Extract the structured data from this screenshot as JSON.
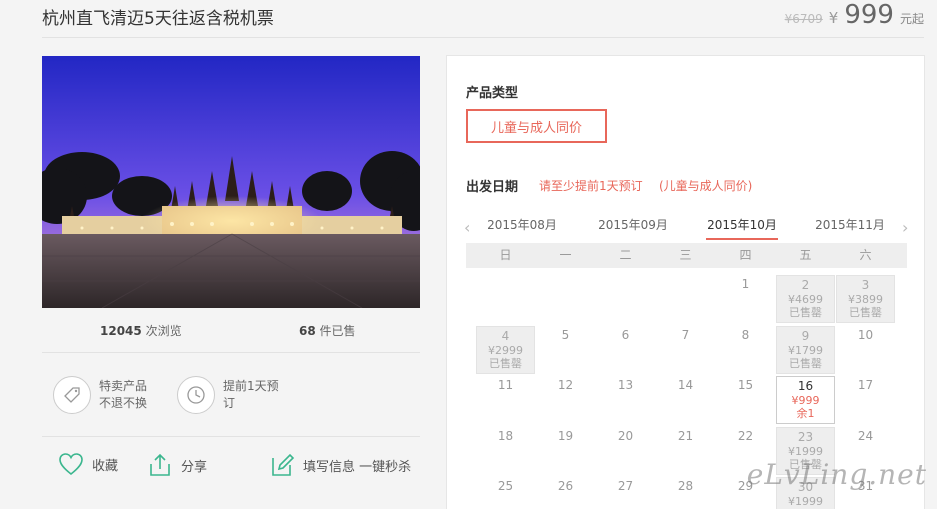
{
  "product": {
    "title": "杭州直飞清迈5天往返含税机票",
    "original_price": "¥6709",
    "currency": "¥",
    "price": "999",
    "unit": "元起"
  },
  "stats": {
    "views_count": "12045",
    "views_label": "次浏览",
    "sold_count": "68",
    "sold_label": "件已售"
  },
  "features": [
    {
      "icon": "tag-icon",
      "line1": "特卖产品",
      "line2": "不退不换"
    },
    {
      "icon": "clock-icon",
      "line1": "提前1天预",
      "line2": "订"
    }
  ],
  "actions": {
    "favorite": "收藏",
    "share": "分享",
    "fill_info": "填写信息 一键秒杀"
  },
  "booking": {
    "product_type_label": "产品类型",
    "product_type_option": "儿童与成人同价",
    "date_label": "出发日期",
    "date_note1": "请至少提前1天预订",
    "date_note2": "(儿童与成人同价)",
    "months": [
      "2015年08月",
      "2015年09月",
      "2015年10月",
      "2015年11月"
    ],
    "active_month_index": 2,
    "weekdays": [
      "日",
      "一",
      "二",
      "三",
      "四",
      "五",
      "六"
    ],
    "calendar": [
      [
        null,
        null,
        null,
        null,
        {
          "d": "1"
        },
        {
          "d": "2",
          "p": "¥4699",
          "s": "已售罄",
          "st": "soldout"
        },
        {
          "d": "3",
          "p": "¥3899",
          "s": "已售罄",
          "st": "soldout"
        }
      ],
      [
        {
          "d": "4",
          "p": "¥2999",
          "s": "已售罄",
          "st": "soldout"
        },
        {
          "d": "5"
        },
        {
          "d": "6"
        },
        {
          "d": "7"
        },
        {
          "d": "8"
        },
        {
          "d": "9",
          "p": "¥1799",
          "s": "已售罄",
          "st": "soldout"
        },
        {
          "d": "10"
        }
      ],
      [
        {
          "d": "11"
        },
        {
          "d": "12"
        },
        {
          "d": "13"
        },
        {
          "d": "14"
        },
        {
          "d": "15"
        },
        {
          "d": "16",
          "p": "¥999",
          "s": "余1",
          "st": "avail"
        },
        {
          "d": "17"
        }
      ],
      [
        {
          "d": "18"
        },
        {
          "d": "19"
        },
        {
          "d": "20"
        },
        {
          "d": "21"
        },
        {
          "d": "22"
        },
        {
          "d": "23",
          "p": "¥1999",
          "s": "已售罄",
          "st": "soldout"
        },
        {
          "d": "24"
        }
      ],
      [
        {
          "d": "25"
        },
        {
          "d": "26"
        },
        {
          "d": "27"
        },
        {
          "d": "28"
        },
        {
          "d": "29"
        },
        {
          "d": "30",
          "p": "¥1999",
          "s": "",
          "st": "soldout"
        },
        {
          "d": "31"
        }
      ]
    ]
  },
  "watermark": "eLvLing.net",
  "colors": {
    "accent": "#e8675a",
    "icon_green": "#3bb68e",
    "sky_top": "#2a2fc8",
    "sky_bottom": "#8a60e0"
  }
}
